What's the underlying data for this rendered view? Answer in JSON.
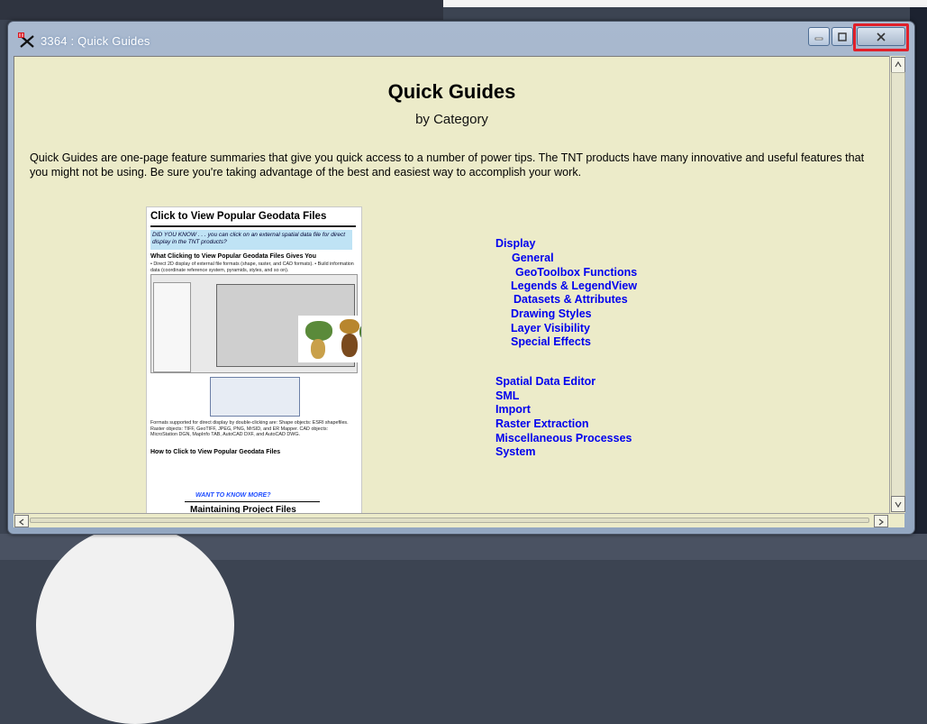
{
  "window": {
    "title": "3364 : Quick Guides"
  },
  "page": {
    "title": "Quick Guides",
    "subtitle": "by Category",
    "intro": "Quick Guides are one-page feature summaries that give you quick access to a number of power tips. The TNT products have many innovative and useful features that you might not be using. Be sure you're taking advantage of the best and easiest way to accomplish your work."
  },
  "guide_preview": {
    "title": "Click to View Popular Geodata Files",
    "did_you_know": "DID YOU KNOW . . . you can click on an external spatial data file for direct display in the TNT products?",
    "section1": "What Clicking to View Popular Geodata Files Gives You",
    "section1_text": "• Direct 2D display of external file formats (shape, raster, and CAD formats). • Build information data (coordinate reference system, pyramids, styles, and so on).",
    "formats_text": "Formats supported for direct display by double-clicking are: Shape objects: ESRI shapefiles. Raster objects: TIFF, GeoTIFF, JPEG, PNG, MrSID, and ER Mapper. CAD objects: MicroStation DGN, MapInfo TAB, AutoCAD DXF, and AutoCAD DWG.",
    "section2": "How to Click to View Popular Geodata Files",
    "want_more": "WANT TO KNOW MORE?",
    "banner_title": "Maintaining Project Files"
  },
  "categories": {
    "display": "Display",
    "general": "General",
    "geotoolbox": "GeoToolbox Functions",
    "legends": "Legends & LegendView",
    "datasets": "Datasets & Attributes",
    "drawing_styles": "Drawing Styles",
    "layer_visibility": "Layer Visibility",
    "special_effects": "Special Effects",
    "spatial_data_editor": "Spatial Data Editor",
    "sml": "SML",
    "import": "Import",
    "raster_extraction": "Raster Extraction",
    "misc_processes": "Miscellaneous Processes",
    "system": "System"
  },
  "colors": {
    "link": "#0000ee",
    "background": "#ecebc9",
    "close_highlight": "#e0202a"
  }
}
